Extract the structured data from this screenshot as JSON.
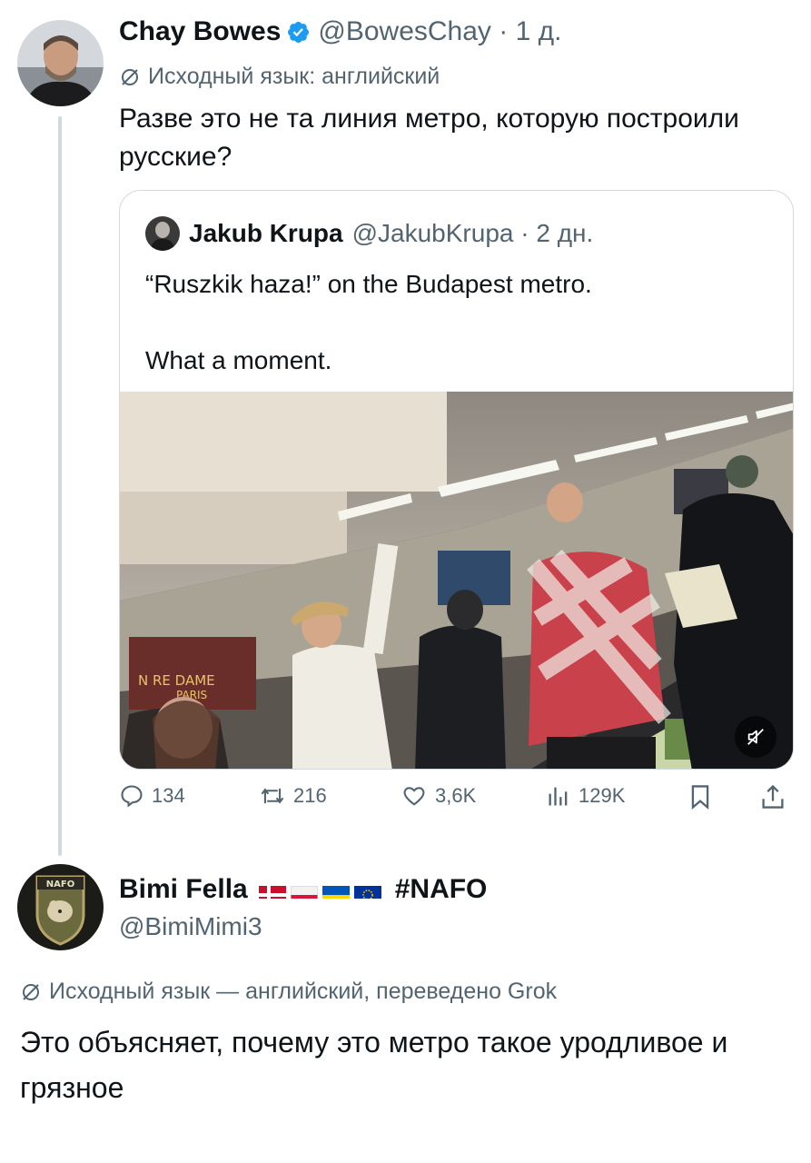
{
  "tweet1": {
    "author_name": "Chay Bowes",
    "handle": "@BowesChay",
    "time": "1 д.",
    "translation_note": "Исходный язык: английский",
    "text": "Разве это не та линия метро, которую построили русские?"
  },
  "quote": {
    "author_name": "Jakub Krupa",
    "handle": "@JakubKrupa",
    "time": "2 дн.",
    "text": "“Ruszkik haza!” on the Budapest metro.\n\nWhat a moment.",
    "poster_text_1": "N  RE DAME",
    "poster_text_2": "PARIS"
  },
  "actions": {
    "replies": "134",
    "reposts": "216",
    "likes": "3,6K",
    "views": "129K"
  },
  "tweet2": {
    "author_name": "Bimi Fella",
    "hashtag": "#NAFO",
    "handle": "@BimiMimi3",
    "badge_text": "NAFO",
    "translation_note": "Исходный язык — английский, переведено Grok",
    "text": "Это объясняет, почему это метро такое уродливое и грязное"
  },
  "colors": {
    "text": "#0f1419",
    "muted": "#536471",
    "verified": "#1d9bf0",
    "border": "#cfd9de"
  },
  "icons": [
    "verified-icon",
    "translate-icon",
    "reply-icon",
    "repost-icon",
    "like-icon",
    "views-icon",
    "bookmark-icon",
    "share-icon",
    "mute-icon"
  ]
}
